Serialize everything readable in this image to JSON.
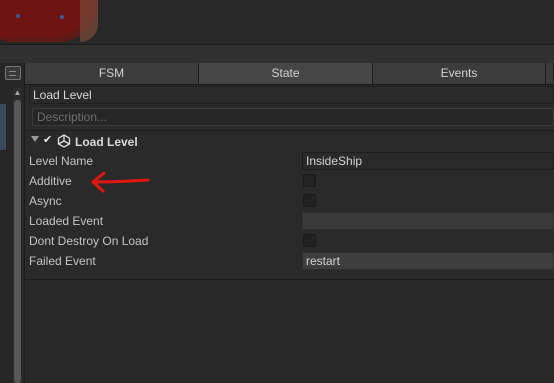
{
  "tabs": [
    {
      "label": "FSM",
      "active": false
    },
    {
      "label": "State",
      "active": true
    },
    {
      "label": "Events",
      "active": false
    }
  ],
  "state": {
    "name": "Load Level",
    "description_placeholder": "Description..."
  },
  "action": {
    "title": "Load Level",
    "enabled": true,
    "check_glyph": "✔",
    "collapse_icon": "triangle-down-icon",
    "action_icon": "unity-logo-icon"
  },
  "parameters": [
    {
      "label": "Level Name",
      "type": "text",
      "value": "InsideShip"
    },
    {
      "label": "Additive",
      "type": "checkbox",
      "checked": false
    },
    {
      "label": "Async",
      "type": "checkbox",
      "checked": false
    },
    {
      "label": "Loaded Event",
      "type": "event",
      "value": ""
    },
    {
      "label": "Dont Destroy On Load",
      "type": "checkbox",
      "checked": false
    },
    {
      "label": "Failed Event",
      "type": "event",
      "value": "restart"
    }
  ],
  "annotation": {
    "icon": "red-arrow-icon",
    "color": "#e3150f"
  },
  "colors": {
    "panel_bg": "#2a2a2a",
    "tab_active": "#464646",
    "graph_node": "#6e1412"
  }
}
